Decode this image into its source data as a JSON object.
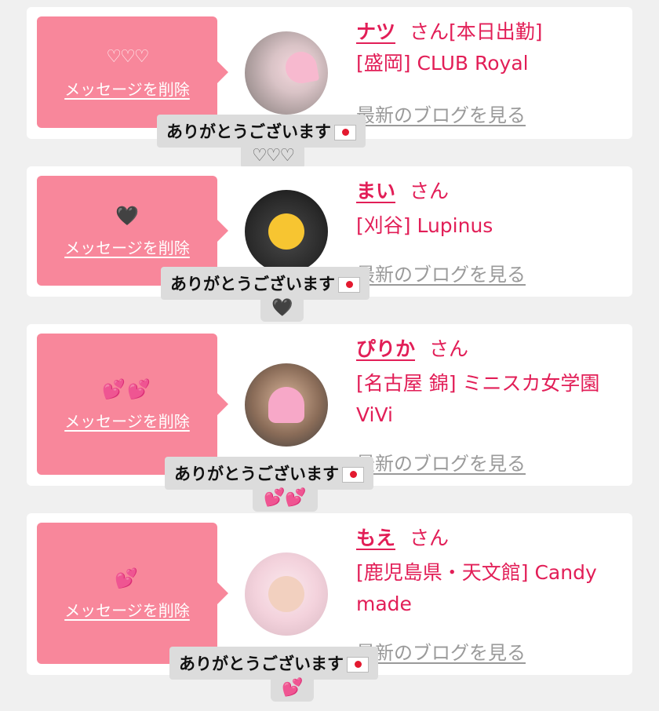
{
  "colors": {
    "accent": "#e21e57",
    "message_box": "#f8879b",
    "card_bg": "#ffffff",
    "page_bg": "#f0f0f0",
    "link_gray": "#9a9a9a"
  },
  "cards": [
    {
      "message": "♡♡♡",
      "delete_label": "メッセージを削除",
      "name": "ナツ",
      "honorific": "さん",
      "status": "[本日出勤]",
      "shop": "[盛岡] CLUB Royal",
      "blog_link": "最新のブログを見る",
      "tooltip": "ありがとうございます",
      "tooltip_tail": "♡♡♡",
      "avatar_icon": "profile-photo"
    },
    {
      "message": "🖤",
      "delete_label": "メッセージを削除",
      "name": "まい",
      "honorific": "さん",
      "status": "",
      "shop": "[刈谷] Lupinus",
      "blog_link": "最新のブログを見る",
      "tooltip": "ありがとうございます",
      "tooltip_tail": "🖤",
      "avatar_icon": "profile-photo"
    },
    {
      "message": "💕💕",
      "delete_label": "メッセージを削除",
      "name": "ぴりか",
      "honorific": "さん",
      "status": "",
      "shop": "[名古屋 錦] ミニスカ女学園 ViVi",
      "blog_link": "最新のブログを見る",
      "tooltip": "ありがとうございます",
      "tooltip_tail": "💕💕",
      "avatar_icon": "profile-photo"
    },
    {
      "message": "💕",
      "delete_label": "メッセージを削除",
      "name": "もえ",
      "honorific": "さん",
      "status": "",
      "shop": "[鹿児島県・天文館] Candy made",
      "blog_link": "最新のブログを見る",
      "tooltip": "ありがとうございます",
      "tooltip_tail": "💕",
      "avatar_icon": "profile-photo"
    }
  ]
}
